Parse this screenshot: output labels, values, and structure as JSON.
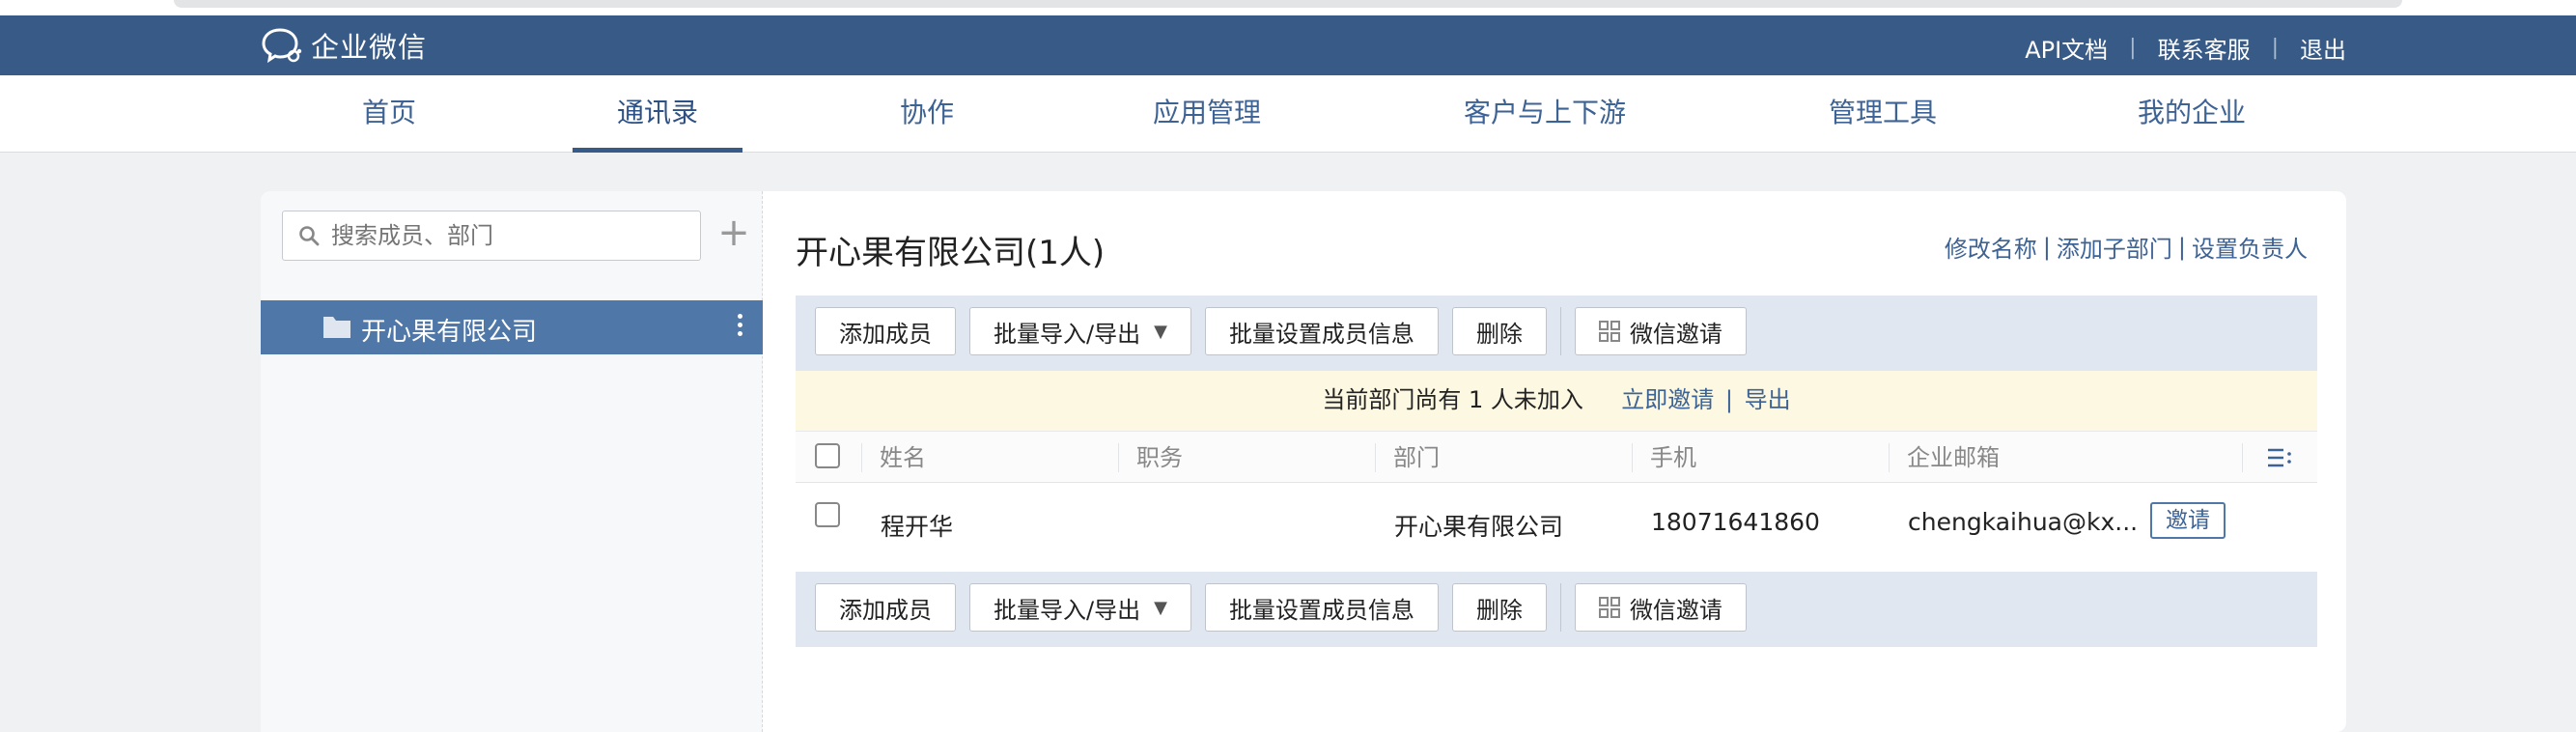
{
  "brand": {
    "name": "企业微信"
  },
  "top_links": [
    "API文档",
    "联系客服",
    "退出"
  ],
  "nav": {
    "items": [
      "首页",
      "通讯录",
      "协作",
      "应用管理",
      "客户与上下游",
      "管理工具",
      "我的企业"
    ],
    "active": "通讯录"
  },
  "sidebar": {
    "search_placeholder": "搜索成员、部门",
    "add_label": "+",
    "tree": [
      {
        "label": "开心果有限公司",
        "selected": true,
        "icon": "folder-icon"
      }
    ]
  },
  "department": {
    "title": "开心果有限公司(1人)",
    "actions": [
      "修改名称",
      "添加子部门",
      "设置负责人"
    ]
  },
  "toolbar": {
    "add_member": "添加成员",
    "batch_import_export": "批量导入/导出",
    "batch_set_info": "批量设置成员信息",
    "delete": "删除",
    "wechat_invite": "微信邀请"
  },
  "notice": {
    "text": "当前部门尚有 1 人未加入",
    "invite_now": "立即邀请",
    "export": "导出"
  },
  "table": {
    "columns": [
      "姓名",
      "职务",
      "部门",
      "手机",
      "企业邮箱"
    ],
    "rows": [
      {
        "name": "程开华",
        "title": "",
        "department": "开心果有限公司",
        "phone": "18071641860",
        "email": "chengkaihua@kx...",
        "action": "邀请"
      }
    ]
  },
  "colors": {
    "topbar": "#375a87",
    "accent": "#3d6294",
    "selected_node": "#4f77a7",
    "toolbar_bg": "#e1e7f1",
    "notice_bg": "#fdf8e1"
  }
}
